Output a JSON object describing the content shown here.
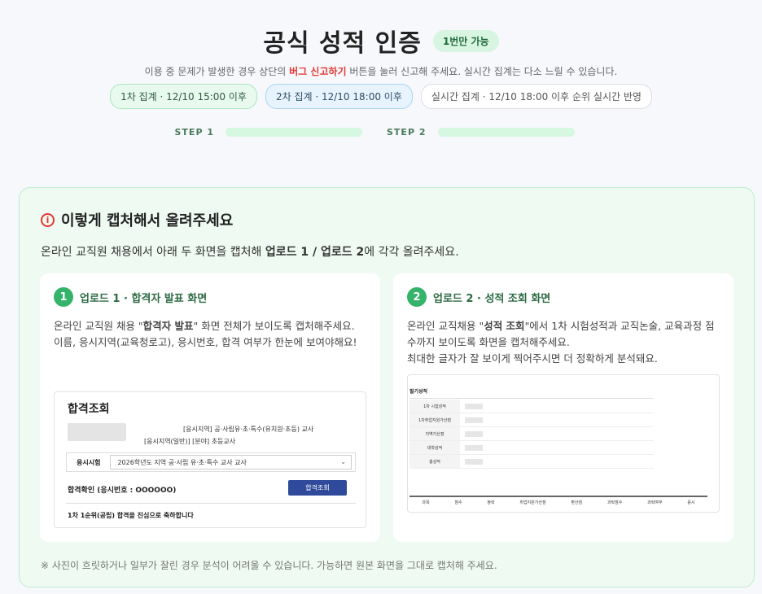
{
  "header": {
    "title": "공식 성적 인증",
    "badge": "1번만 가능",
    "subtitle_pre": "이용 중 문제가 발생한 경우 상단의 ",
    "subtitle_bug": "버그 신고하기",
    "subtitle_post": " 버튼을 눌러 신고해 주세요. 실시간 집계는 다소 느릴 수 있습니다."
  },
  "pills": [
    "1차 집계 · 12/10 15:00 이후",
    "2차 집계 · 12/10 18:00 이후",
    "실시간 집계 · 12/10 18:00 이후 순위 실시간 반영"
  ],
  "steps": [
    "STEP 1",
    "STEP 2"
  ],
  "panel": {
    "heading": "이렇게 캡처해서 올려주세요",
    "desc_pre": "온라인 교직원 채용에서 아래 두 화면을 캡처해 ",
    "desc_bold": "업로드 1 / 업로드 2",
    "desc_post": "에 각각 올려주세요.",
    "footnote": "※ 사진이 흐릿하거나 일부가 잘린 경우 분석이 어려울 수 있습니다. 가능하면 원본 화면을 그대로 캡처해 주세요."
  },
  "card1": {
    "num": "1",
    "title": "업로드 1 · 합격자 발표 화면",
    "p1_pre": "온라인 교직원 채용 \"",
    "p1_bold": "합격자 발표",
    "p1_post": "\" 화면 전체가 보이도록 캡처해주세요.",
    "p2": "이름, 응시지역(교육청로고), 응시번호, 합격 여부가 한눈에 보여야해요!",
    "mock": {
      "title": "합격조회",
      "info1": "[응시지역] 공·사립유·초·특수(유치원·초등) 교사",
      "info2": "[응시지역(일반)] [분야] 초등교사",
      "select_label": "응시시험",
      "select_value": "2026학년도      지역 공·사립 유·초·특수 교사 교사",
      "confirm": "합격확인 (응시번호 : OOOOOO)",
      "button": "합격조회",
      "congrats": "1차 1순위(공립) 합격을 진심으로 축하합니다"
    }
  },
  "card2": {
    "num": "2",
    "title": "업로드 2 · 성적 조회 화면",
    "p1_pre": "온라인 교직채용 \"",
    "p1_bold": "성적 조회",
    "p1_post": "\"에서 1차 시험성적과 교직논술, 교육과정 점수까지 보이도록 화면을 캡처해주세요.",
    "p2": "최대한 글자가 잘 보이게 찍어주시면 더 정확하게 분석돼요.",
    "mock": {
      "title": "필기성적",
      "rows": [
        "1차 시험성적",
        "1차취업지원가산점",
        "지역가산점",
        "대학성적",
        "총성적"
      ],
      "heads": [
        "과목",
        "점수",
        "참락",
        "취업지원가산점",
        "환산점",
        "과락점수",
        "과락여부",
        "응시"
      ]
    }
  }
}
